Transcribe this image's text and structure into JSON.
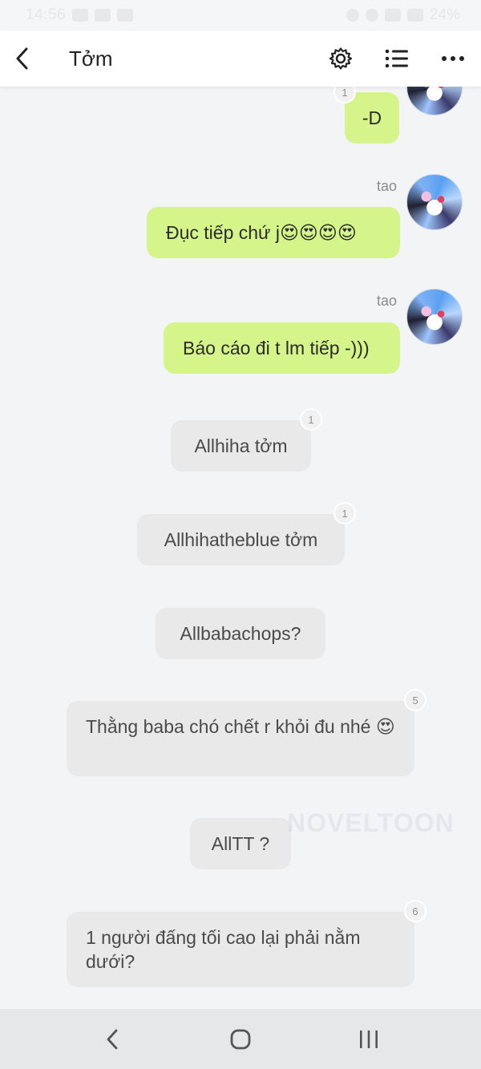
{
  "status_bar": {
    "time": "14:56",
    "battery": "24%"
  },
  "header": {
    "title": "Tởm"
  },
  "messages": {
    "m1": {
      "text": "-D",
      "badge": "1"
    },
    "m2": {
      "sender": "tao",
      "text": "Đục tiếp chứ j😍😍😍😍"
    },
    "m3": {
      "sender": "tao",
      "text": "Báo cáo đi t lm tiếp -)))"
    },
    "m4": {
      "text": "Allhiha tởm",
      "badge": "1"
    },
    "m5": {
      "text": "Allhihatheblue tởm",
      "badge": "1"
    },
    "m6": {
      "text": "Allbabachops?"
    },
    "m7": {
      "text": "Thằng baba chó chết r khỏi đu nhé 😍",
      "badge": "5"
    },
    "m8": {
      "text": "AllTT ?"
    },
    "m9": {
      "text": "1 người đấng tối cao lại phải nằm dưới?",
      "badge": "6"
    }
  },
  "watermark": "NOVELTOON",
  "icons": {
    "back": "chevron-left-icon",
    "settings": "gear-icon",
    "list": "list-icon",
    "more": "more-horizontal-icon",
    "nav_back": "nav-back-icon",
    "nav_home": "nav-home-icon",
    "nav_recents": "nav-recents-icon"
  }
}
